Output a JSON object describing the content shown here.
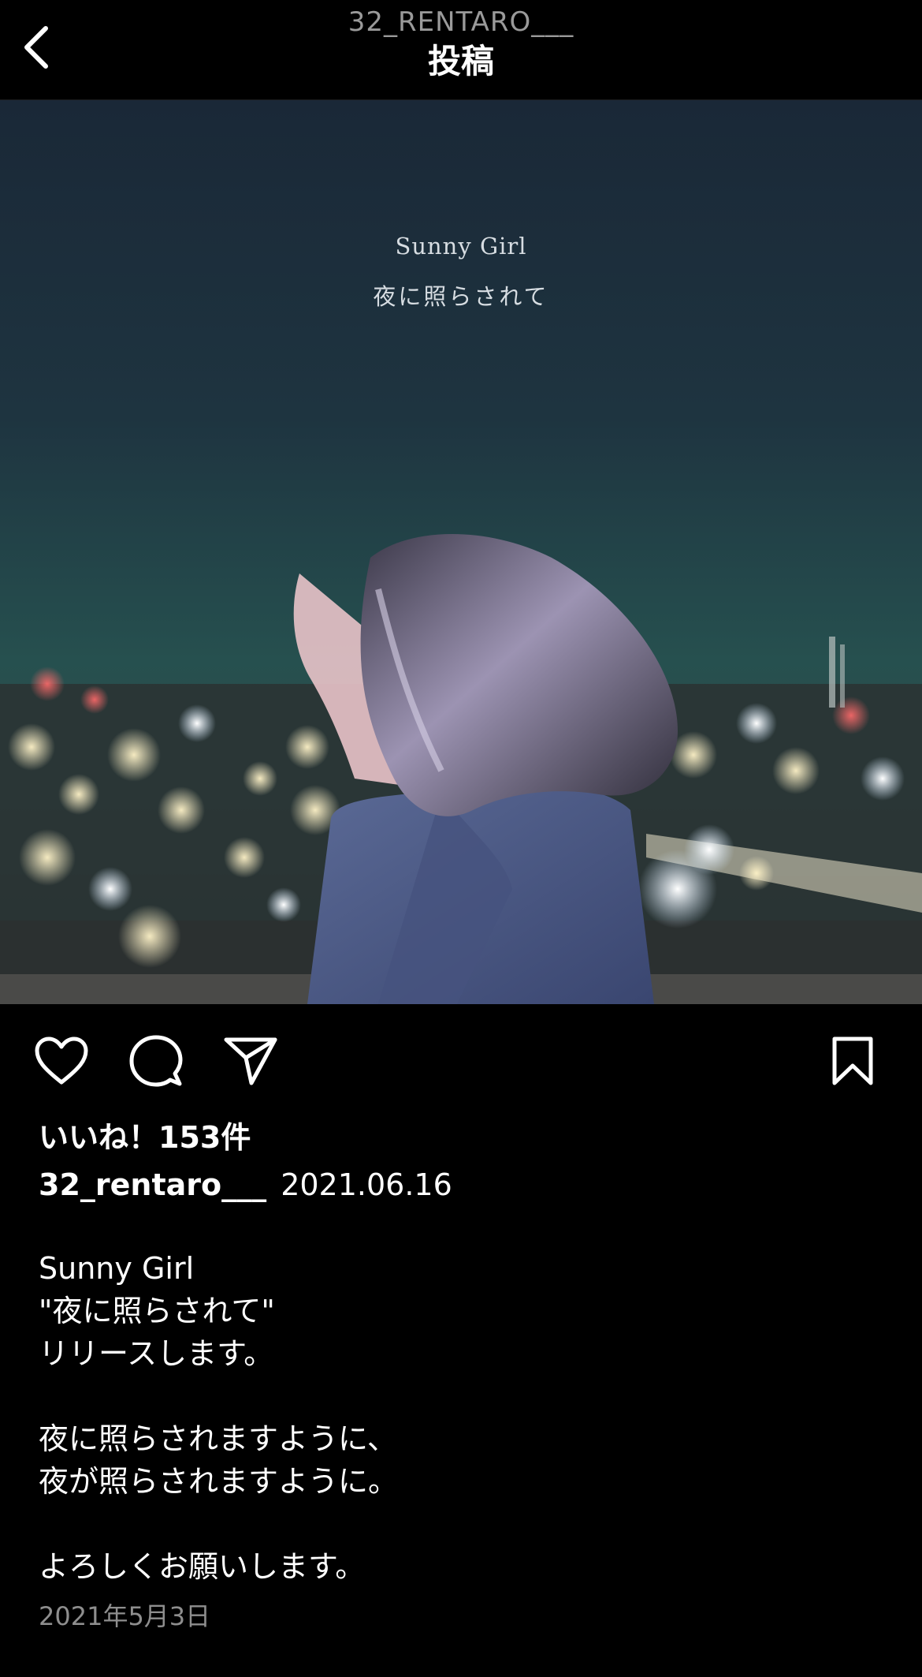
{
  "header": {
    "username": "32_RENTARO___",
    "title": "投稿",
    "back_icon": "chevron-left-icon"
  },
  "image": {
    "overlay_title": "Sunny Girl",
    "overlay_subtitle": "夜に照らされて"
  },
  "actions": {
    "like_icon": "heart-icon",
    "comment_icon": "comment-icon",
    "share_icon": "send-icon",
    "save_icon": "bookmark-icon"
  },
  "likes_text": "いいね！153件",
  "post_meta": {
    "username": "32_rentaro___",
    "date": "2021.06.16"
  },
  "caption_lines": [
    "Sunny Girl",
    "\"夜に照らされて\"",
    "リリースします。",
    "夜に照らされますように、",
    "夜が照らされますように。",
    "よろしくお願いします。"
  ],
  "posted_date": "2021年5月3日",
  "colors": {
    "background": "#000000",
    "text": "#ffffff",
    "muted": "#8e8e8e"
  }
}
